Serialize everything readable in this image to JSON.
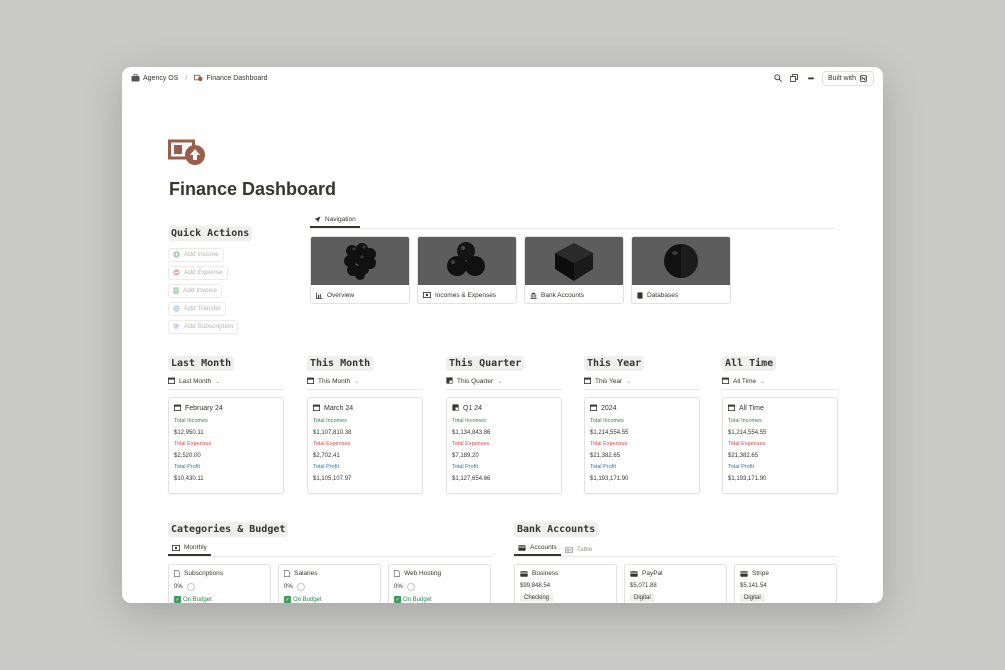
{
  "breadcrumb": {
    "workspace": "Agency OS",
    "separator": "/",
    "page": "Finance Dashboard"
  },
  "topbar": {
    "built_with": "Built with"
  },
  "page": {
    "title": "Finance Dashboard",
    "icon": "money-icon",
    "accent_color": "#9b5e4a"
  },
  "quick_actions": {
    "heading": "Quick Actions",
    "items": [
      {
        "label": "Add Income",
        "icon": "plus-circle-icon",
        "color": "#6c9b7a"
      },
      {
        "label": "Add Expense",
        "icon": "minus-circle-icon",
        "color": "#d98a85"
      },
      {
        "label": "Add Invoice",
        "icon": "invoice-icon",
        "color": "#7fb08e"
      },
      {
        "label": "Add Transfer",
        "icon": "transfer-icon",
        "color": "#8bb3d8"
      },
      {
        "label": "Add Subscription",
        "icon": "tag-icon",
        "color": "#c49fd6"
      }
    ]
  },
  "navigation": {
    "tab_label": "Navigation",
    "cards": [
      {
        "label": "Overview",
        "icon": "chart-icon"
      },
      {
        "label": "Incomes & Expenses",
        "icon": "money-icon"
      },
      {
        "label": "Bank Accounts",
        "icon": "bank-icon"
      },
      {
        "label": "Databases",
        "icon": "database-icon"
      }
    ]
  },
  "periods": [
    {
      "heading": "Last Month",
      "view": "Last Month",
      "card_title": "February 24",
      "incomes_label": "Total Incomes",
      "incomes": "$12,950.11",
      "expenses_label": "Total Expenses",
      "expenses": "$2,520.00",
      "profit_label": "Total Profit",
      "profit": "$10,430.11"
    },
    {
      "heading": "This Month",
      "view": "This Month",
      "card_title": "March 24",
      "incomes_label": "Total Incomes",
      "incomes": "$1,107,810.38",
      "expenses_label": "Total Expenses",
      "expenses": "$2,702.41",
      "profit_label": "Total Profit",
      "profit": "$1,105,107.97"
    },
    {
      "heading": "This Quarter",
      "view": "This Quarter",
      "card_title": "Q1 24",
      "incomes_label": "Total Incomes",
      "incomes": "$1,134,843.86",
      "expenses_label": "Total Expenses",
      "expenses": "$7,189.20",
      "profit_label": "Total Profit",
      "profit": "$1,127,654.66"
    },
    {
      "heading": "This Year",
      "view": "This Year",
      "card_title": "2024",
      "incomes_label": "Total Incomes",
      "incomes": "$1,214,554.55",
      "expenses_label": "Total Expenses",
      "expenses": "$21,382.65",
      "profit_label": "Total Profit",
      "profit": "$1,193,171.90"
    },
    {
      "heading": "All Time",
      "view": "All Time",
      "card_title": "All Time",
      "incomes_label": "Total Incomes",
      "incomes": "$1,214,554.55",
      "expenses_label": "Total Expenses",
      "expenses": "$21,382.65",
      "profit_label": "Total Profit",
      "profit": "$1,193,171.90"
    }
  ],
  "categories": {
    "heading": "Categories & Budget",
    "tab": "Monthly",
    "items": [
      {
        "name": "Subscriptions",
        "pct": "0%",
        "status": "On Budget"
      },
      {
        "name": "Salaries",
        "pct": "0%",
        "status": "On Budget"
      },
      {
        "name": "Web Hosting",
        "pct": "0%",
        "status": "On Budget"
      }
    ]
  },
  "bank_accounts": {
    "heading": "Bank Accounts",
    "tabs": [
      "Accounts",
      "Table"
    ],
    "items": [
      {
        "name": "Business",
        "amount": "$99,848.54",
        "type": "Checking"
      },
      {
        "name": "PayPal",
        "amount": "$5,071.88",
        "type": "Digital"
      },
      {
        "name": "Stripe",
        "amount": "$5,141.54",
        "type": "Digital"
      }
    ]
  }
}
